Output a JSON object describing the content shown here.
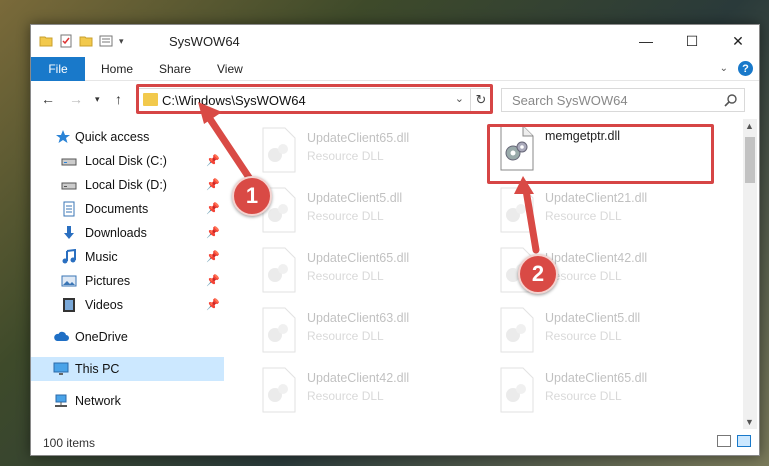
{
  "window": {
    "title": "SysWOW64",
    "controls": {
      "minimize": "—",
      "maximize": "☐",
      "close": "✕"
    }
  },
  "ribbon": {
    "file_label": "File",
    "tabs": [
      "Home",
      "Share",
      "View"
    ],
    "help_label": "?"
  },
  "nav": {
    "address": "C:\\Windows\\SysWOW64",
    "search_placeholder": "Search SysWOW64"
  },
  "sidebar": {
    "items": [
      {
        "label": "Quick access",
        "icon": "star-icon",
        "pinned": false
      },
      {
        "label": "Local Disk (C:)",
        "icon": "drive-icon",
        "pinned": true
      },
      {
        "label": "Local Disk (D:)",
        "icon": "drive-icon",
        "pinned": true
      },
      {
        "label": "Documents",
        "icon": "documents-icon",
        "pinned": true
      },
      {
        "label": "Downloads",
        "icon": "download-icon",
        "pinned": true
      },
      {
        "label": "Music",
        "icon": "music-icon",
        "pinned": true
      },
      {
        "label": "Pictures",
        "icon": "pictures-icon",
        "pinned": true
      },
      {
        "label": "Videos",
        "icon": "videos-icon",
        "pinned": true
      },
      {
        "label": "OneDrive",
        "icon": "cloud-icon",
        "pinned": false
      },
      {
        "label": "This PC",
        "icon": "computer-icon",
        "pinned": false,
        "selected": true
      },
      {
        "label": "Network",
        "icon": "network-icon",
        "pinned": false
      }
    ]
  },
  "files": {
    "left_column": [
      {
        "name": "UpdateClient65.dll",
        "type": "Resource DLL"
      },
      {
        "name": "UpdateClient5.dll",
        "type": "Resource DLL"
      },
      {
        "name": "UpdateClient65.dll",
        "type": "Resource DLL"
      },
      {
        "name": "UpdateClient63.dll",
        "type": "Resource DLL"
      },
      {
        "name": "UpdateClient42.dll",
        "type": "Resource DLL"
      }
    ],
    "right_column": [
      {
        "name": "memgetptr.dll",
        "type": "",
        "highlighted": true
      },
      {
        "name": "UpdateClient21.dll",
        "type": "Resource DLL"
      },
      {
        "name": "UpdateClient42.dll",
        "type": "Resource DLL"
      },
      {
        "name": "UpdateClient5.dll",
        "type": "Resource DLL"
      },
      {
        "name": "UpdateClient65.dll",
        "type": "Resource DLL"
      }
    ]
  },
  "status": {
    "item_count": "100 items"
  },
  "annotations": {
    "marker1": "1",
    "marker2": "2",
    "color": "#d64545"
  }
}
